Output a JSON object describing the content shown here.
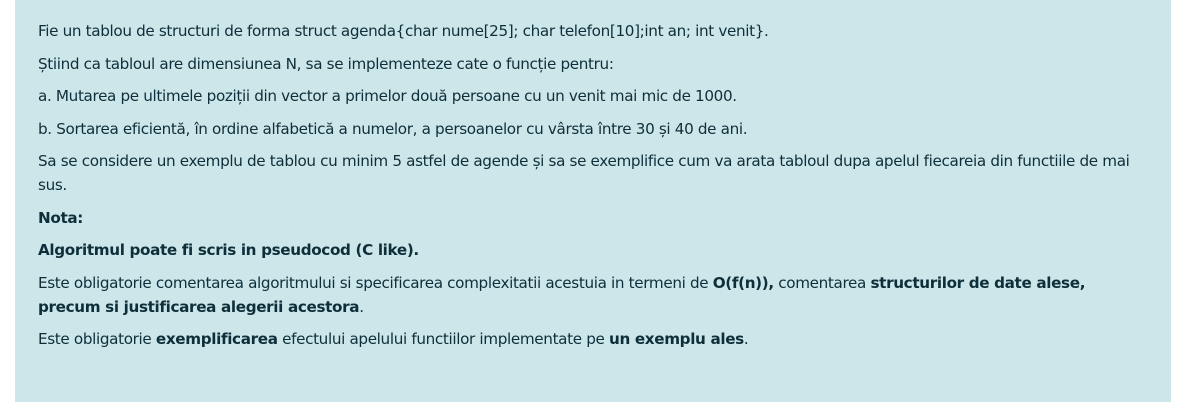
{
  "content": {
    "p1": "Fie un tablou de structuri de forma struct agenda{char nume[25]; char telefon[10];int an; int venit}.",
    "p2": "Știind ca tabloul are dimensiunea N, sa se implementeze cate o funcție pentru:",
    "p3": "a. Mutarea pe ultimele poziții din vector a primelor două  persoane cu un venit mai mic de 1000.",
    "p4": "b. Sortarea eficientă, în ordine alfabetică a numelor, a persoanelor cu vârsta între 30 și 40 de ani.",
    "p5": "Sa se considere un exemplu de tablou cu minim 5 astfel de agende și sa se exemplifice cum va arata tabloul dupa apelul fiecareia din functiile de mai sus.",
    "nota": "Nota:",
    "algoritm": "Algoritmul poate fi scris in pseudocod (C like).",
    "p8": {
      "t1": "Este obligatorie comentarea algoritmului si specificarea complexitatii acestuia in termeni de ",
      "b1": "O(f(n)),",
      "t2": " comentarea ",
      "b2": "structurilor de date alese, precum si justificarea alegerii acestora",
      "t3": "."
    },
    "p9": {
      "t1": "Este obligatorie ",
      "b1": "exemplificarea",
      "t2": " efectului apelului functiilor implementate pe ",
      "b2": "un exemplu ales",
      "t3": "."
    }
  }
}
